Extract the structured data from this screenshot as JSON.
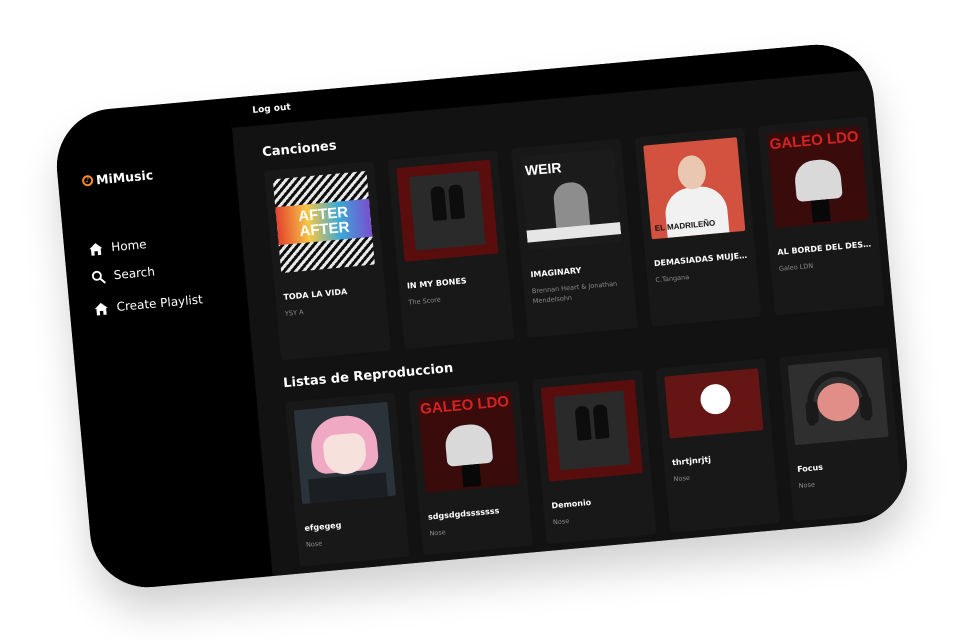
{
  "app": {
    "name": "MiMusic"
  },
  "sidebar": {
    "items": [
      {
        "label": "Home",
        "icon": "home-icon"
      },
      {
        "label": "Search",
        "icon": "search-icon"
      },
      {
        "label": "Create Playlist",
        "icon": "home-icon"
      }
    ]
  },
  "topbar": {
    "logout_label": "Log out"
  },
  "songs": {
    "title": "Canciones",
    "items": [
      {
        "title": "TODA LA VIDA",
        "artist": "YSY A",
        "cover_text": "AFTER AFTER"
      },
      {
        "title": "IN MY BONES",
        "artist": "The Score"
      },
      {
        "title": "IMAGINARY",
        "artist": "Brennan Heart & Jonathan Mendelsohn",
        "cover_text": "WEIR"
      },
      {
        "title": "DEMASIADAS MUJE...",
        "artist": "C.Tangana",
        "cover_text": "EL MADRILEÑO"
      },
      {
        "title": "AL BORDE DEL DES...",
        "artist": "Galeo LDN",
        "cover_text": "GALEO LDO"
      }
    ]
  },
  "playlists": {
    "title": "Listas de Reproduccion",
    "items": [
      {
        "title": "efgegeg",
        "owner": "Nose"
      },
      {
        "title": "sdgsdgdsssssss",
        "owner": "Nose",
        "cover_text": "GALEO LDO"
      },
      {
        "title": "Demonio",
        "owner": "Nose"
      },
      {
        "title": "thrtjnrjtj",
        "owner": "Nose"
      },
      {
        "title": "Focus",
        "owner": "Nose"
      }
    ]
  },
  "colors": {
    "accent": "#f08a2c",
    "sidebar": "#000000",
    "main": "#121212",
    "card": "#181818"
  }
}
